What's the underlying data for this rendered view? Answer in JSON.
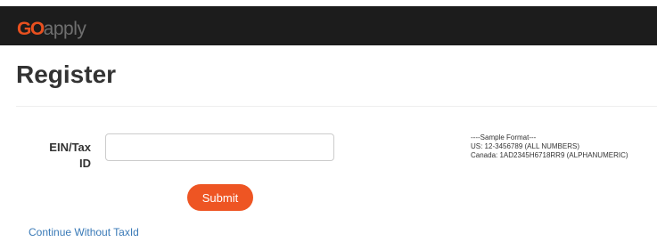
{
  "header": {
    "logo_go": "GO",
    "logo_apply": "apply"
  },
  "page": {
    "title": "Register"
  },
  "form": {
    "ein_label_line1": "EIN/Tax",
    "ein_label_line2": "ID",
    "ein_value": "",
    "ein_placeholder": "",
    "submit_label": "Submit",
    "sample_format": {
      "heading": "----Sample Format---",
      "us": "US: 12-3456789 (ALL NUMBERS)",
      "canada": "Canada: 1AD2345H6718RR9 (ALPHANUMERIC)"
    },
    "continue_link": "Continue Without TaxId"
  },
  "colors": {
    "brand_orange": "#ee5523",
    "header_bg": "#1c1c1c",
    "link_blue": "#3a7ab7"
  }
}
